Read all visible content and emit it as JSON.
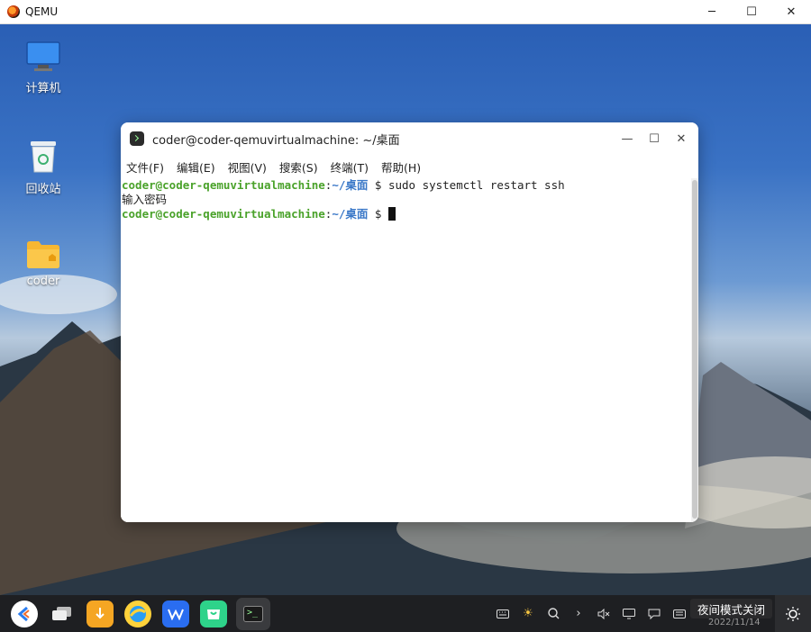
{
  "qemu": {
    "title": "QEMU",
    "minimize": "─",
    "maximize": "☐",
    "close": "✕"
  },
  "desktop": {
    "icons": [
      {
        "label": "计算机",
        "icon": "computer-icon"
      },
      {
        "label": "回收站",
        "icon": "trash-icon"
      },
      {
        "label": "coder",
        "icon": "home-folder-icon"
      }
    ]
  },
  "terminal": {
    "title": "coder@coder-qemuvirtualmachine: ~/桌面",
    "controls": {
      "minimize": "—",
      "maximize": "☐",
      "close": "✕"
    },
    "menu": [
      "文件(F)",
      "编辑(E)",
      "视图(V)",
      "搜索(S)",
      "终端(T)",
      "帮助(H)"
    ],
    "lines": [
      {
        "user": "coder@coder-qemuvirtualmachine",
        "sep": ":",
        "path": "~/桌面",
        "prompt": " $ ",
        "cmd": "sudo systemctl restart ssh"
      },
      {
        "text": "输入密码"
      },
      {
        "user": "coder@coder-qemuvirtualmachine",
        "sep": ":",
        "path": "~/桌面",
        "prompt": " $ ",
        "cmd": ""
      }
    ]
  },
  "taskbar": {
    "apps": [
      "launcher-icon",
      "multitask-icon",
      "download-icon",
      "browser-icon",
      "wps-icon",
      "store-icon",
      "terminal-icon"
    ],
    "tray": [
      "keyboard-icon",
      "brightness-icon",
      "search-icon",
      "chevron-right-icon",
      "mute-icon",
      "screen-icon",
      "notification-icon",
      "keyboard-layout-icon"
    ],
    "tooltip": "夜间模式关闭",
    "clock_peek": "2022/11/14"
  }
}
